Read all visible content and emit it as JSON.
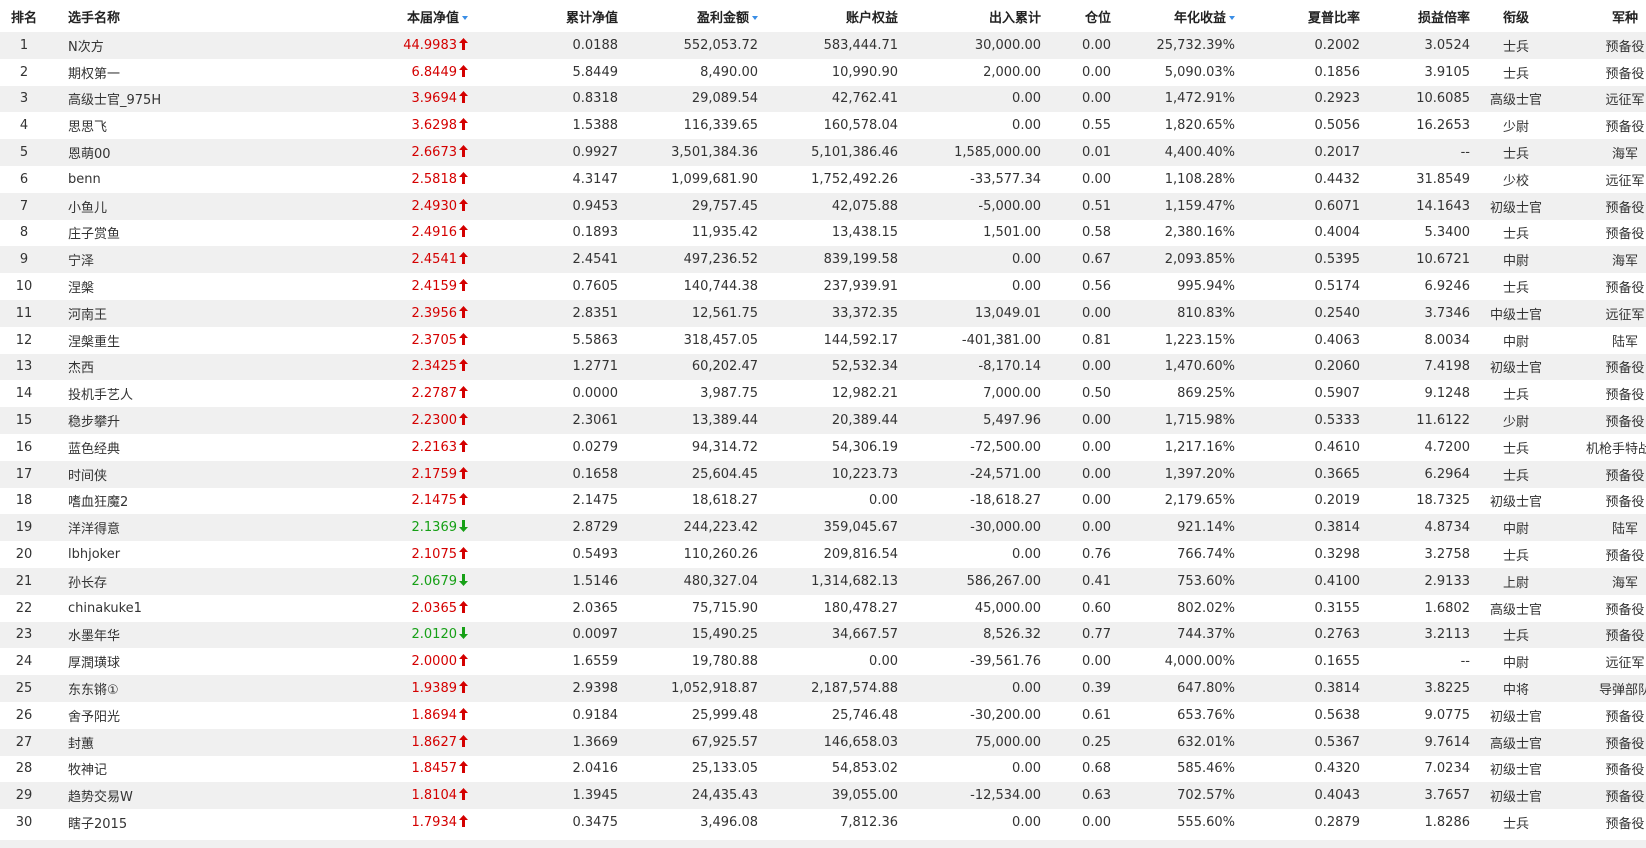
{
  "headers": {
    "rank": "排名",
    "name": "选手名称",
    "nav": "本届净值",
    "cum_nav": "累计净值",
    "profit": "盈利金额",
    "equity": "账户权益",
    "flow": "出入累计",
    "position": "仓位",
    "annual": "年化收益",
    "sharpe": "夏普比率",
    "ratio": "损益倍率",
    "rank_title": "衔级",
    "branch": "军种"
  },
  "colors": {
    "up": "#d40000",
    "down": "#16a016",
    "sort_icon": "#3a8ee6",
    "row_stripe": "#f0f0f0"
  },
  "rows": [
    {
      "rank": "1",
      "name": "N次方",
      "nav": "44.9983",
      "trend": "up",
      "cum": "0.0188",
      "profit": "552,053.72",
      "equity": "583,444.71",
      "flow": "30,000.00",
      "pos": "0.00",
      "annual": "25,732.39%",
      "sharpe": "0.2002",
      "ratio": "3.0524",
      "title": "士兵",
      "branch": "预备役"
    },
    {
      "rank": "2",
      "name": "期权第一",
      "nav": "6.8449",
      "trend": "up",
      "cum": "5.8449",
      "profit": "8,490.00",
      "equity": "10,990.90",
      "flow": "2,000.00",
      "pos": "0.00",
      "annual": "5,090.03%",
      "sharpe": "0.1856",
      "ratio": "3.9105",
      "title": "士兵",
      "branch": "预备役"
    },
    {
      "rank": "3",
      "name": "高级士官_975H",
      "nav": "3.9694",
      "trend": "up",
      "cum": "0.8318",
      "profit": "29,089.54",
      "equity": "42,762.41",
      "flow": "0.00",
      "pos": "0.00",
      "annual": "1,472.91%",
      "sharpe": "0.2923",
      "ratio": "10.6085",
      "title": "高级士官",
      "branch": "远征军"
    },
    {
      "rank": "4",
      "name": "思思飞",
      "nav": "3.6298",
      "trend": "up",
      "cum": "1.5388",
      "profit": "116,339.65",
      "equity": "160,578.04",
      "flow": "0.00",
      "pos": "0.55",
      "annual": "1,820.65%",
      "sharpe": "0.5056",
      "ratio": "16.2653",
      "title": "少尉",
      "branch": "预备役"
    },
    {
      "rank": "5",
      "name": "恩萌00",
      "nav": "2.6673",
      "trend": "up",
      "cum": "0.9927",
      "profit": "3,501,384.36",
      "equity": "5,101,386.46",
      "flow": "1,585,000.00",
      "pos": "0.01",
      "annual": "4,400.40%",
      "sharpe": "0.2017",
      "ratio": "--",
      "title": "士兵",
      "branch": "海军"
    },
    {
      "rank": "6",
      "name": "benn",
      "nav": "2.5818",
      "trend": "up",
      "cum": "4.3147",
      "profit": "1,099,681.90",
      "equity": "1,752,492.26",
      "flow": "-33,577.34",
      "pos": "0.00",
      "annual": "1,108.28%",
      "sharpe": "0.4432",
      "ratio": "31.8549",
      "title": "少校",
      "branch": "远征军"
    },
    {
      "rank": "7",
      "name": "小鱼儿",
      "nav": "2.4930",
      "trend": "up",
      "cum": "0.9453",
      "profit": "29,757.45",
      "equity": "42,075.88",
      "flow": "-5,000.00",
      "pos": "0.51",
      "annual": "1,159.47%",
      "sharpe": "0.6071",
      "ratio": "14.1643",
      "title": "初级士官",
      "branch": "预备役"
    },
    {
      "rank": "8",
      "name": "庄子赏鱼",
      "nav": "2.4916",
      "trend": "up",
      "cum": "0.1893",
      "profit": "11,935.42",
      "equity": "13,438.15",
      "flow": "1,501.00",
      "pos": "0.58",
      "annual": "2,380.16%",
      "sharpe": "0.4004",
      "ratio": "5.3400",
      "title": "士兵",
      "branch": "预备役"
    },
    {
      "rank": "9",
      "name": "宁泽",
      "nav": "2.4541",
      "trend": "up",
      "cum": "2.4541",
      "profit": "497,236.52",
      "equity": "839,199.58",
      "flow": "0.00",
      "pos": "0.67",
      "annual": "2,093.85%",
      "sharpe": "0.5395",
      "ratio": "10.6721",
      "title": "中尉",
      "branch": "海军"
    },
    {
      "rank": "10",
      "name": "涅槃",
      "nav": "2.4159",
      "trend": "up",
      "cum": "0.7605",
      "profit": "140,744.38",
      "equity": "237,939.91",
      "flow": "0.00",
      "pos": "0.56",
      "annual": "995.94%",
      "sharpe": "0.5174",
      "ratio": "6.9246",
      "title": "士兵",
      "branch": "预备役"
    },
    {
      "rank": "11",
      "name": "河南王",
      "nav": "2.3956",
      "trend": "up",
      "cum": "2.8351",
      "profit": "12,561.75",
      "equity": "33,372.35",
      "flow": "13,049.01",
      "pos": "0.00",
      "annual": "810.83%",
      "sharpe": "0.2540",
      "ratio": "3.7346",
      "title": "中级士官",
      "branch": "远征军"
    },
    {
      "rank": "12",
      "name": "涅槃重生",
      "nav": "2.3705",
      "trend": "up",
      "cum": "5.5863",
      "profit": "318,457.05",
      "equity": "144,592.17",
      "flow": "-401,381.00",
      "pos": "0.81",
      "annual": "1,223.15%",
      "sharpe": "0.4063",
      "ratio": "8.0034",
      "title": "中尉",
      "branch": "陆军"
    },
    {
      "rank": "13",
      "name": "杰西",
      "nav": "2.3425",
      "trend": "up",
      "cum": "1.2771",
      "profit": "60,202.47",
      "equity": "52,532.34",
      "flow": "-8,170.14",
      "pos": "0.00",
      "annual": "1,470.60%",
      "sharpe": "0.2060",
      "ratio": "7.4198",
      "title": "初级士官",
      "branch": "预备役"
    },
    {
      "rank": "14",
      "name": "投机手艺人",
      "nav": "2.2787",
      "trend": "up",
      "cum": "0.0000",
      "profit": "3,987.75",
      "equity": "12,982.21",
      "flow": "7,000.00",
      "pos": "0.50",
      "annual": "869.25%",
      "sharpe": "0.5907",
      "ratio": "9.1248",
      "title": "士兵",
      "branch": "预备役"
    },
    {
      "rank": "15",
      "name": "稳步攀升",
      "nav": "2.2300",
      "trend": "up",
      "cum": "2.3061",
      "profit": "13,389.44",
      "equity": "20,389.44",
      "flow": "5,497.96",
      "pos": "0.00",
      "annual": "1,715.98%",
      "sharpe": "0.5333",
      "ratio": "11.6122",
      "title": "少尉",
      "branch": "预备役"
    },
    {
      "rank": "16",
      "name": "蓝色经典",
      "nav": "2.2163",
      "trend": "up",
      "cum": "0.0279",
      "profit": "94,314.72",
      "equity": "54,306.19",
      "flow": "-72,500.00",
      "pos": "0.00",
      "annual": "1,217.16%",
      "sharpe": "0.4610",
      "ratio": "4.7200",
      "title": "士兵",
      "branch": "机枪手特战营"
    },
    {
      "rank": "17",
      "name": "时间侠",
      "nav": "2.1759",
      "trend": "up",
      "cum": "0.1658",
      "profit": "25,604.45",
      "equity": "10,223.73",
      "flow": "-24,571.00",
      "pos": "0.00",
      "annual": "1,397.20%",
      "sharpe": "0.3665",
      "ratio": "6.2964",
      "title": "士兵",
      "branch": "预备役"
    },
    {
      "rank": "18",
      "name": "嗜血狂魔2",
      "nav": "2.1475",
      "trend": "up",
      "cum": "2.1475",
      "profit": "18,618.27",
      "equity": "0.00",
      "flow": "-18,618.27",
      "pos": "0.00",
      "annual": "2,179.65%",
      "sharpe": "0.2019",
      "ratio": "18.7325",
      "title": "初级士官",
      "branch": "预备役"
    },
    {
      "rank": "19",
      "name": "洋洋得意",
      "nav": "2.1369",
      "trend": "down",
      "cum": "2.8729",
      "profit": "244,223.42",
      "equity": "359,045.67",
      "flow": "-30,000.00",
      "pos": "0.00",
      "annual": "921.14%",
      "sharpe": "0.3814",
      "ratio": "4.8734",
      "title": "中尉",
      "branch": "陆军"
    },
    {
      "rank": "20",
      "name": "lbhjoker",
      "nav": "2.1075",
      "trend": "up",
      "cum": "0.5493",
      "profit": "110,260.26",
      "equity": "209,816.54",
      "flow": "0.00",
      "pos": "0.76",
      "annual": "766.74%",
      "sharpe": "0.3298",
      "ratio": "3.2758",
      "title": "士兵",
      "branch": "预备役"
    },
    {
      "rank": "21",
      "name": "孙长存",
      "nav": "2.0679",
      "trend": "down",
      "cum": "1.5146",
      "profit": "480,327.04",
      "equity": "1,314,682.13",
      "flow": "586,267.00",
      "pos": "0.41",
      "annual": "753.60%",
      "sharpe": "0.4100",
      "ratio": "2.9133",
      "title": "上尉",
      "branch": "海军"
    },
    {
      "rank": "22",
      "name": "chinakuke1",
      "nav": "2.0365",
      "trend": "up",
      "cum": "2.0365",
      "profit": "75,715.90",
      "equity": "180,478.27",
      "flow": "45,000.00",
      "pos": "0.60",
      "annual": "802.02%",
      "sharpe": "0.3155",
      "ratio": "1.6802",
      "title": "高级士官",
      "branch": "预备役"
    },
    {
      "rank": "23",
      "name": "水墨年华",
      "nav": "2.0120",
      "trend": "down",
      "cum": "0.0097",
      "profit": "15,490.25",
      "equity": "34,667.57",
      "flow": "8,526.32",
      "pos": "0.77",
      "annual": "744.37%",
      "sharpe": "0.2763",
      "ratio": "3.2113",
      "title": "士兵",
      "branch": "预备役"
    },
    {
      "rank": "24",
      "name": "厚潤璜球",
      "nav": "2.0000",
      "trend": "up",
      "cum": "1.6559",
      "profit": "19,780.88",
      "equity": "0.00",
      "flow": "-39,561.76",
      "pos": "0.00",
      "annual": "4,000.00%",
      "sharpe": "0.1655",
      "ratio": "--",
      "title": "中尉",
      "branch": "远征军"
    },
    {
      "rank": "25",
      "name": "东东锵①",
      "nav": "1.9389",
      "trend": "up",
      "cum": "2.9398",
      "profit": "1,052,918.87",
      "equity": "2,187,574.88",
      "flow": "0.00",
      "pos": "0.39",
      "annual": "647.80%",
      "sharpe": "0.3814",
      "ratio": "3.8225",
      "title": "中将",
      "branch": "导弹部队"
    },
    {
      "rank": "26",
      "name": "舍予阳光",
      "nav": "1.8694",
      "trend": "up",
      "cum": "0.9184",
      "profit": "25,999.48",
      "equity": "25,746.48",
      "flow": "-30,200.00",
      "pos": "0.61",
      "annual": "653.76%",
      "sharpe": "0.5638",
      "ratio": "9.0775",
      "title": "初级士官",
      "branch": "预备役"
    },
    {
      "rank": "27",
      "name": "封蕙",
      "nav": "1.8627",
      "trend": "up",
      "cum": "1.3669",
      "profit": "67,925.57",
      "equity": "146,658.03",
      "flow": "75,000.00",
      "pos": "0.25",
      "annual": "632.01%",
      "sharpe": "0.5367",
      "ratio": "9.7614",
      "title": "高级士官",
      "branch": "预备役"
    },
    {
      "rank": "28",
      "name": "牧神记",
      "nav": "1.8457",
      "trend": "up",
      "cum": "2.0416",
      "profit": "25,133.05",
      "equity": "54,853.02",
      "flow": "0.00",
      "pos": "0.68",
      "annual": "585.46%",
      "sharpe": "0.4320",
      "ratio": "7.0234",
      "title": "初级士官",
      "branch": "预备役"
    },
    {
      "rank": "29",
      "name": "趋势交易W",
      "nav": "1.8104",
      "trend": "up",
      "cum": "1.3945",
      "profit": "24,435.43",
      "equity": "39,055.00",
      "flow": "-12,534.00",
      "pos": "0.63",
      "annual": "702.57%",
      "sharpe": "0.4043",
      "ratio": "3.7657",
      "title": "初级士官",
      "branch": "预备役"
    },
    {
      "rank": "30",
      "name": "瞎子2015",
      "nav": "1.7934",
      "trend": "up",
      "cum": "0.3475",
      "profit": "3,496.08",
      "equity": "7,812.36",
      "flow": "0.00",
      "pos": "0.00",
      "annual": "555.60%",
      "sharpe": "0.2879",
      "ratio": "1.8286",
      "title": "士兵",
      "branch": "预备役"
    }
  ]
}
